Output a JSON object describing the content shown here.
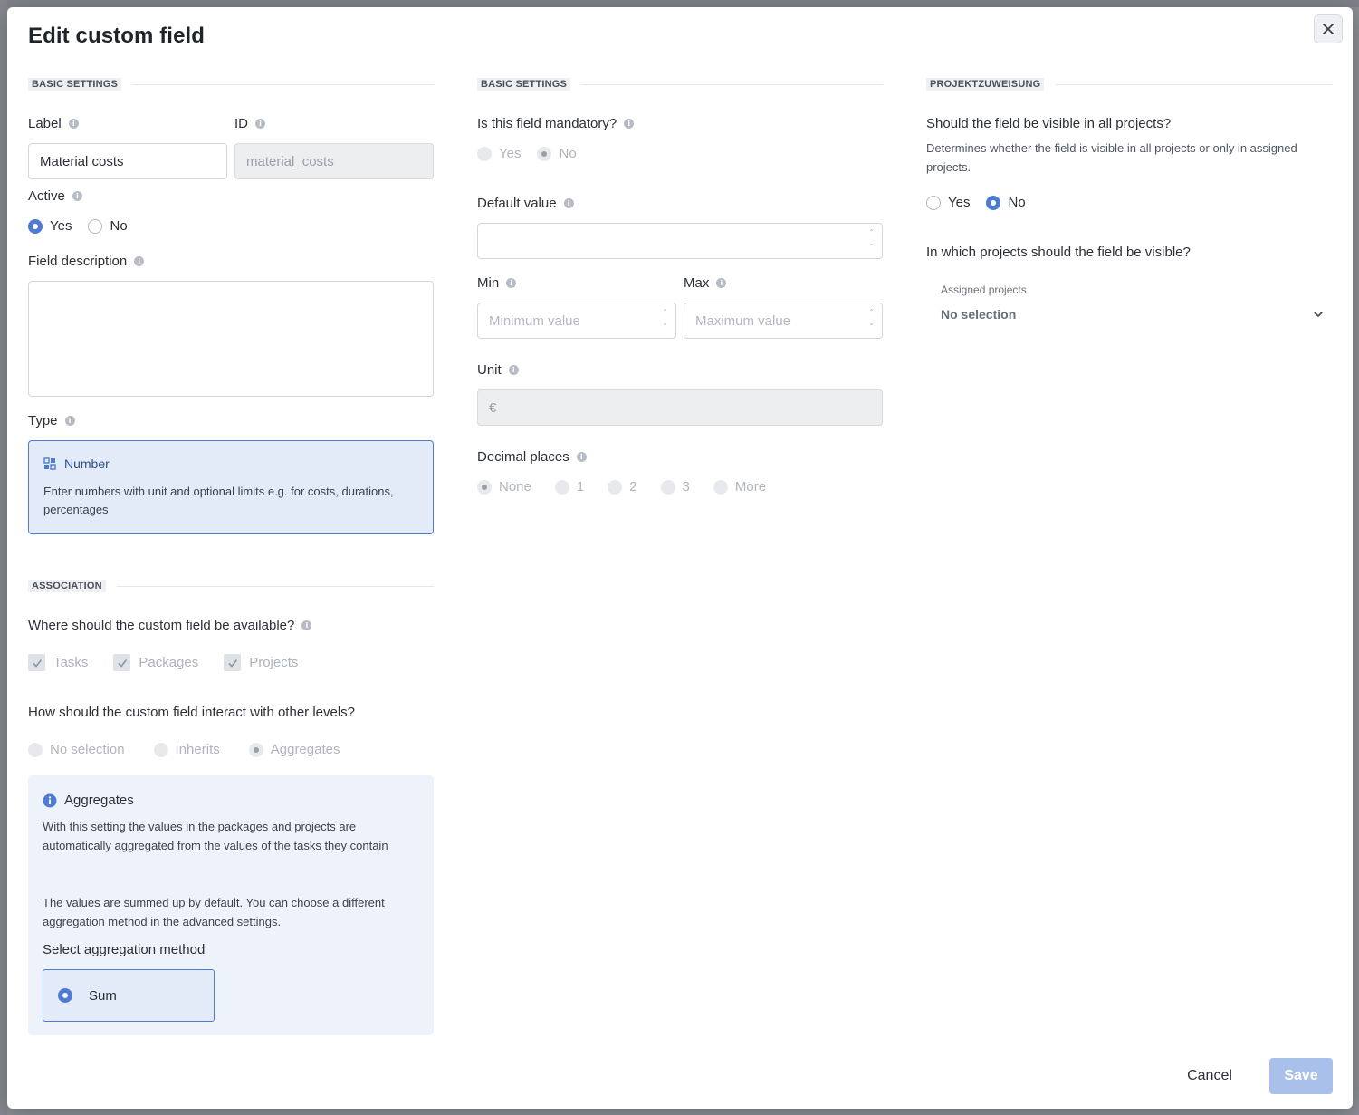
{
  "dialog": {
    "title": "Edit custom field",
    "close_icon": "close-icon"
  },
  "basic_settings_left": {
    "section_title": "BASIC SETTINGS",
    "label": {
      "title": "Label",
      "value": "Material costs"
    },
    "id": {
      "title": "ID",
      "value": "material_costs"
    },
    "active": {
      "title": "Active",
      "options": [
        "Yes",
        "No"
      ],
      "selected": "Yes"
    },
    "field_description": {
      "title": "Field description",
      "value": ""
    },
    "type": {
      "title": "Type",
      "card_title": "Number",
      "card_icon": "grid-icon",
      "card_description": "Enter numbers with unit and optional limits e.g. for costs, durations, percentages"
    }
  },
  "association": {
    "section_title": "ASSOCIATION",
    "availability_question": "Where should the custom field be available?",
    "availability_options": [
      "Tasks",
      "Packages",
      "Projects"
    ],
    "interaction_question": "How should the custom field interact with other levels?",
    "interaction_options": [
      "No selection",
      "Inherits",
      "Aggregates"
    ],
    "interaction_selected": "Aggregates",
    "panel": {
      "title": "Aggregates",
      "text1": "With this setting the values in the packages and projects are automatically aggregated from the values of the tasks they contain",
      "text2": "The values are summed up by default. You can choose a different aggregation method in the advanced settings.",
      "select_label": "Select aggregation method",
      "option": "Sum"
    }
  },
  "basic_settings_middle": {
    "section_title": "BASIC SETTINGS",
    "mandatory": {
      "title": "Is this field mandatory?",
      "options": [
        "Yes",
        "No"
      ],
      "selected": "No"
    },
    "default_value": {
      "title": "Default value",
      "value": ""
    },
    "min": {
      "title": "Min",
      "placeholder": "Minimum value"
    },
    "max": {
      "title": "Max",
      "placeholder": "Maximum value"
    },
    "unit": {
      "title": "Unit",
      "value": "€"
    },
    "decimal_places": {
      "title": "Decimal places",
      "options": [
        "None",
        "1",
        "2",
        "3",
        "More"
      ],
      "selected": "None"
    }
  },
  "project_assignment": {
    "section_title": "PROJEKTZUWEISUNG",
    "visible_question": "Should the field be visible in all projects?",
    "visible_hint": "Determines whether the field is visible in all projects or only in assigned projects.",
    "visible_options": [
      "Yes",
      "No"
    ],
    "visible_selected": "No",
    "which_question": "In which projects should the field be visible?",
    "assigned_label": "Assigned projects",
    "assigned_value": "No selection"
  },
  "footer": {
    "cancel": "Cancel",
    "save": "Save"
  },
  "colors": {
    "accent": "#4f7bd3",
    "card_bg": "#e4ebf8",
    "panel_bg": "#eef3fb",
    "save_disabled": "#a9c0ea"
  }
}
